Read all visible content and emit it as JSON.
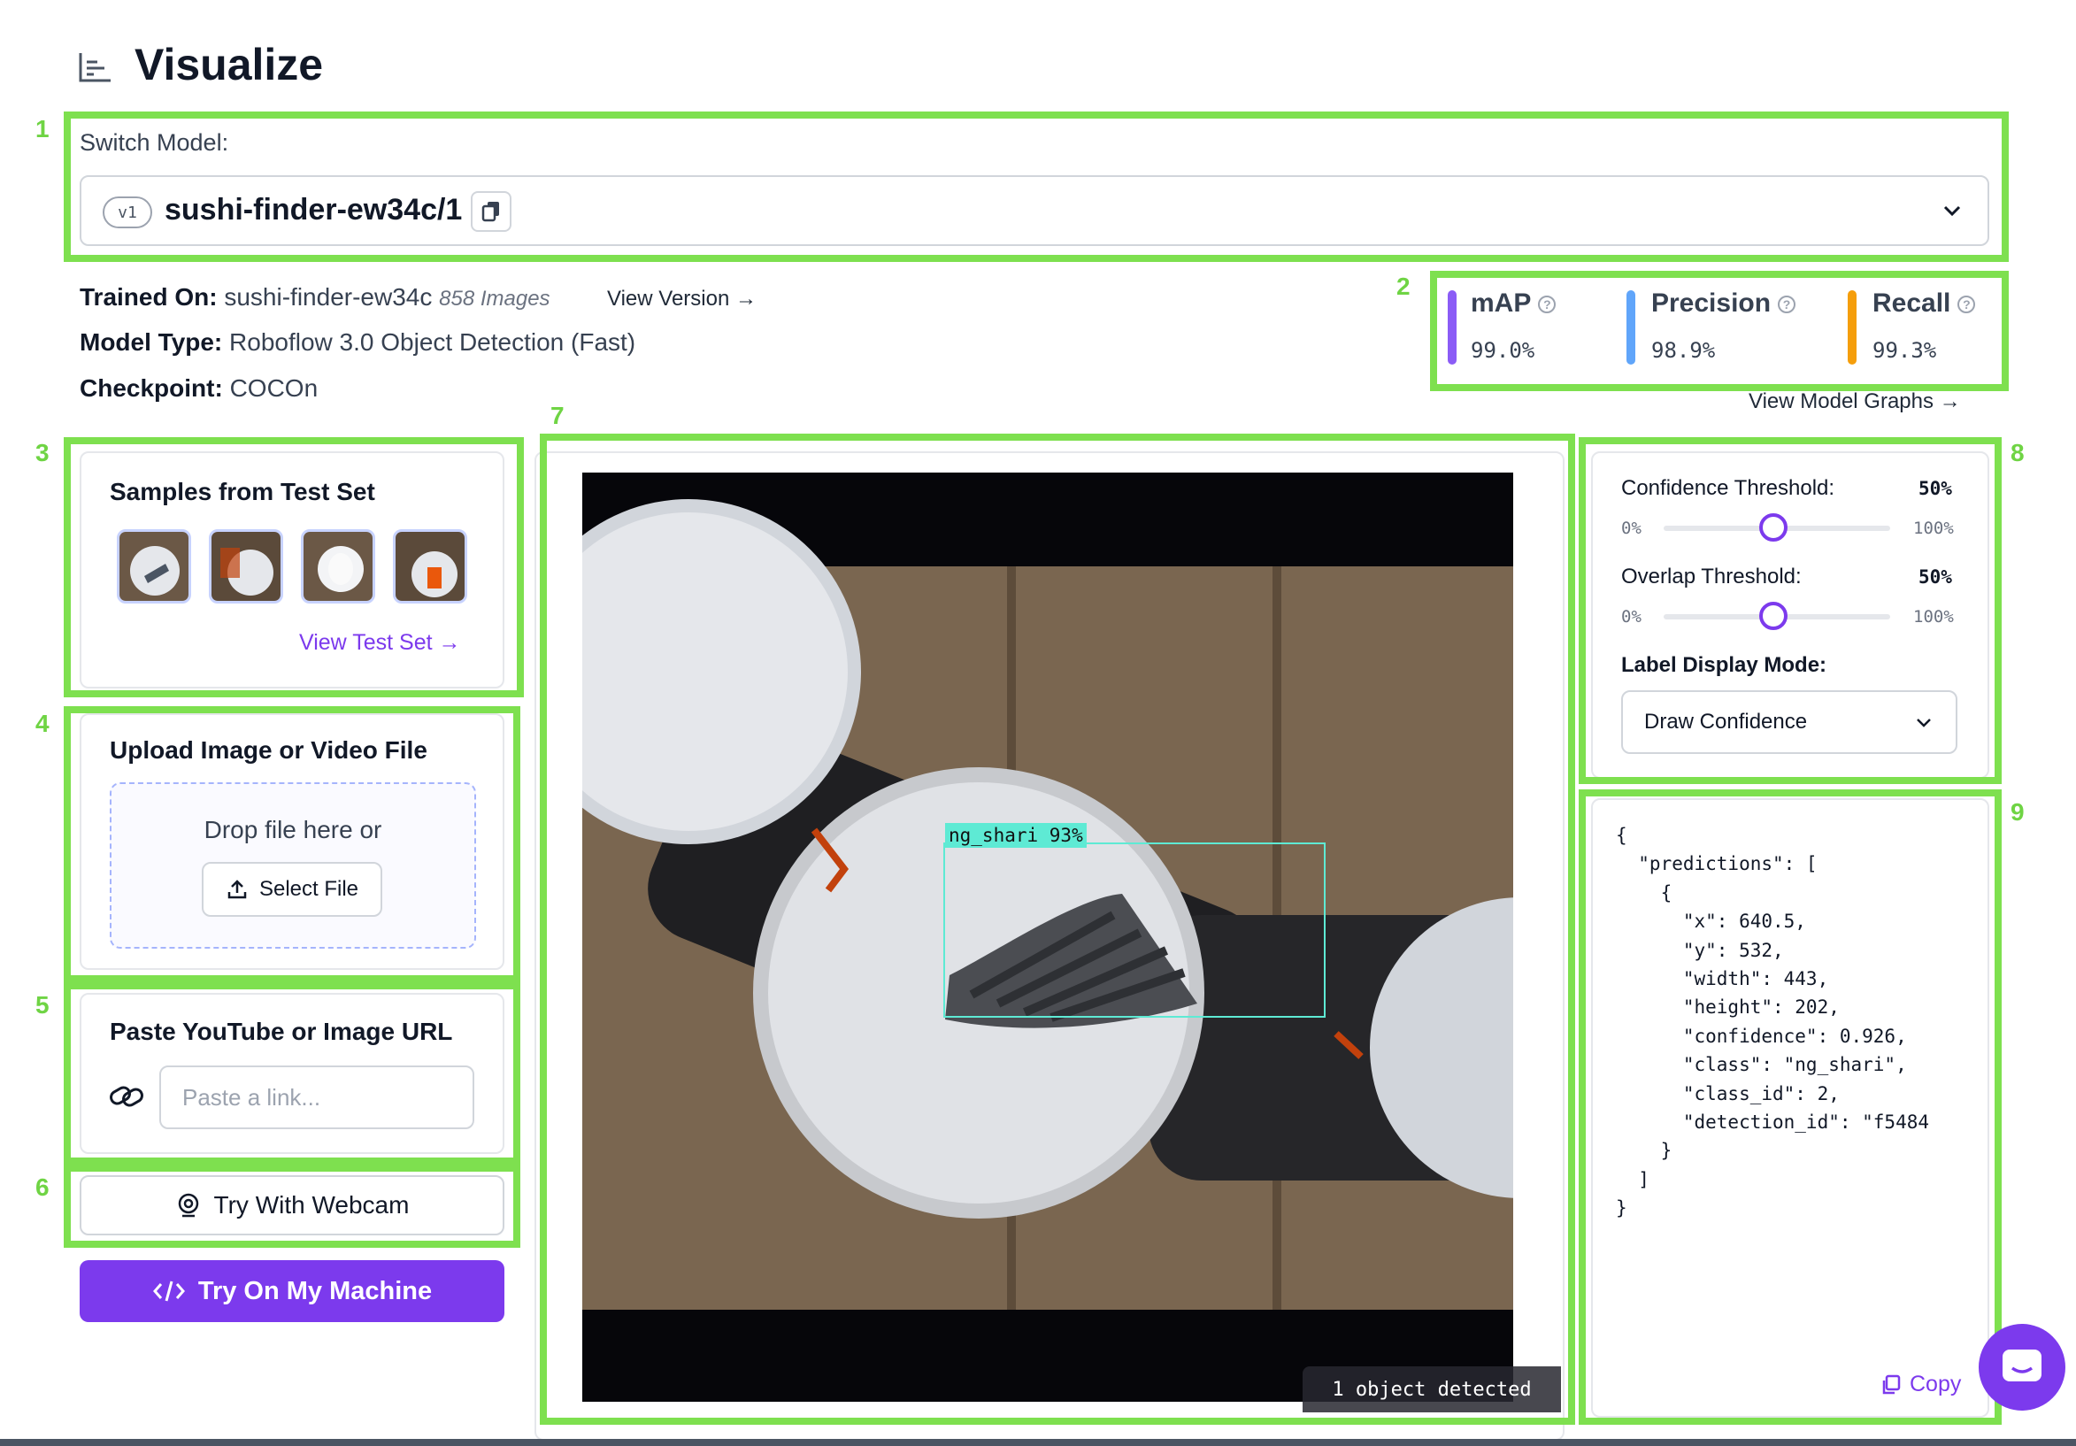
{
  "header": {
    "title": "Visualize",
    "icon": "chart-icon"
  },
  "annotations": [
    "1",
    "2",
    "3",
    "4",
    "5",
    "6",
    "7",
    "8",
    "9"
  ],
  "model": {
    "switch_label": "Switch Model:",
    "version": "v1",
    "name": "sushi-finder-ew34c/1"
  },
  "info": {
    "trained_on_label": "Trained On:",
    "trained_on_value": "sushi-finder-ew34c",
    "images_count": "858 Images",
    "view_version": "View Version →",
    "model_type_label": "Model Type:",
    "model_type_value": "Roboflow 3.0 Object Detection (Fast)",
    "checkpoint_label": "Checkpoint:",
    "checkpoint_value": "COCOn"
  },
  "metrics": [
    {
      "name": "mAP",
      "value": "99.0%",
      "color": "#8b5cf6"
    },
    {
      "name": "Precision",
      "value": "98.9%",
      "color": "#60a5fa"
    },
    {
      "name": "Recall",
      "value": "99.3%",
      "color": "#f59e0b"
    }
  ],
  "view_model_graphs": "View Model Graphs →",
  "samples": {
    "title": "Samples from Test Set",
    "view_link": "View Test Set →"
  },
  "upload": {
    "title": "Upload Image or Video File",
    "drop_text": "Drop file here or",
    "select_button": "Select File"
  },
  "url": {
    "title": "Paste YouTube or Image URL",
    "placeholder": "Paste a link..."
  },
  "webcam_button": "Try With Webcam",
  "machine_button": "Try On My Machine",
  "detection": {
    "label": "ng_shari 93%",
    "count_text": "1 object detected",
    "box_color": "#5eead4"
  },
  "thresholds": {
    "confidence_label": "Confidence Threshold:",
    "confidence_value": "50%",
    "confidence_fraction": 0.5,
    "overlap_label": "Overlap Threshold:",
    "overlap_value": "50%",
    "overlap_fraction": 0.5,
    "min": "0%",
    "max": "100%",
    "label_mode_label": "Label Display Mode:",
    "label_mode_value": "Draw Confidence"
  },
  "json_output": {
    "text": "{\n  \"predictions\": [\n    {\n      \"x\": 640.5,\n      \"y\": 532,\n      \"width\": 443,\n      \"height\": 202,\n      \"confidence\": 0.926,\n      \"class\": \"ng_shari\",\n      \"class_id\": 2,\n      \"detection_id\": \"f5484\n    }\n  ]\n}",
    "copy_label": "Copy"
  },
  "colors": {
    "accent": "#7c3aed",
    "annotation_green": "#7ee04f"
  }
}
